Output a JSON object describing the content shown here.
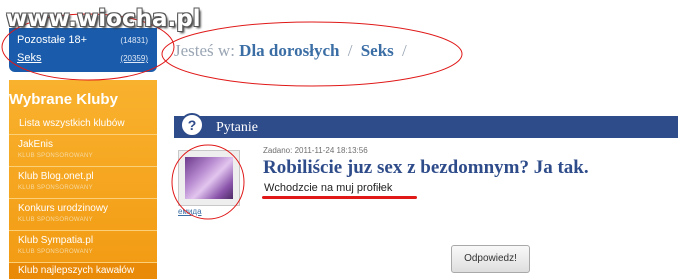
{
  "watermark": "www.wiocha.pl",
  "categories": [
    {
      "label": "Pozostałe 18+",
      "count": "(14831)"
    },
    {
      "label": "Seks",
      "count": "(20359)"
    }
  ],
  "clubs": {
    "title": "Wybrane Kluby",
    "all_link": "Lista wszystkich klubów",
    "items": [
      {
        "name": "JakEnis",
        "sub": "KLUB SPONSOROWANY"
      },
      {
        "name": "Klub Blog.onet.pl",
        "sub": "KLUB SPONSOROWANY"
      },
      {
        "name": "Konkurs urodzinowy",
        "sub": "KLUB SPONSOROWANY"
      },
      {
        "name": "Klub Sympatia.pl",
        "sub": "KLUB SPONSOROWANY"
      }
    ],
    "last": "Klub najlepszych kawałów"
  },
  "breadcrumb": {
    "prefix": "Jesteś w:",
    "items": [
      "Dla dorosłych",
      "Seks"
    ],
    "separator": "/"
  },
  "section": {
    "icon": "question-icon",
    "icon_glyph": "?",
    "title": "Pytanie"
  },
  "question": {
    "author": "емида",
    "meta": "Zadano: 2011-11-24 18:13:56",
    "title": "Robiliście juz sex z bezdomnym? Ja tak.",
    "body": "Wchodzcie na muj profiłek"
  },
  "answer_button": "Odpowiedz!",
  "colors": {
    "brand_blue": "#2f4c8a",
    "orange": "#f29a12",
    "annotation_red": "#e01818"
  }
}
